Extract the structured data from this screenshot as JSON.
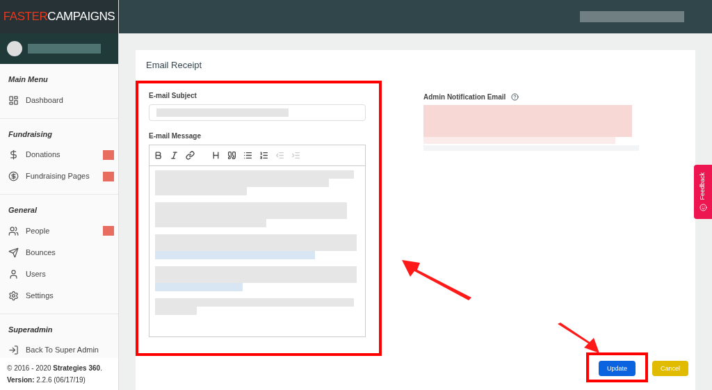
{
  "brand": {
    "part_1": "FASTER",
    "part_2": "CAMPAIGNS"
  },
  "sidebar": {
    "sections": [
      {
        "title": "Main Menu",
        "items": [
          {
            "label": "Dashboard",
            "kind": "dashboard",
            "badge": false
          }
        ]
      },
      {
        "title": "Fundraising",
        "items": [
          {
            "label": "Donations",
            "kind": "dollar",
            "badge": true
          },
          {
            "label": "Fundraising Pages",
            "kind": "dollar-circle",
            "badge": true
          }
        ]
      },
      {
        "title": "General",
        "items": [
          {
            "label": "People",
            "kind": "people",
            "badge": true
          },
          {
            "label": "Bounces",
            "kind": "send",
            "badge": false
          },
          {
            "label": "Users",
            "kind": "user",
            "badge": false
          },
          {
            "label": "Settings",
            "kind": "gear",
            "badge": false
          }
        ]
      },
      {
        "title": "Superadmin",
        "items": [
          {
            "label": "Back To Super Admin",
            "kind": "login",
            "badge": false
          }
        ]
      }
    ],
    "footer": {
      "copyright": "© 2016 - 2020 **Strategies 360**.",
      "version": "**Version:** 2.2.6 (06/17/19)"
    }
  },
  "card": {
    "title": "Email Receipt",
    "subject": {
      "label": "E-mail Subject"
    },
    "message": {
      "label": "E-mail Message",
      "toolbar": [
        {
          "kind": "bold",
          "disabled": false
        },
        {
          "kind": "italic",
          "disabled": false
        },
        {
          "kind": "link",
          "disabled": false
        },
        {
          "kind": "heading",
          "disabled": false
        },
        {
          "kind": "quote",
          "disabled": false
        },
        {
          "kind": "bullets",
          "disabled": false
        },
        {
          "kind": "numbers",
          "disabled": false
        },
        {
          "kind": "outdent",
          "disabled": true
        },
        {
          "kind": "indent",
          "disabled": true
        }
      ]
    },
    "admin": {
      "label": "Admin Notification Email"
    },
    "buttons": [
      {
        "label": "Update",
        "kind": "primary",
        "highlighted": true
      },
      {
        "label": "Cancel",
        "kind": "warning",
        "highlighted": false
      }
    ]
  },
  "feedback": {
    "label": "Feedback"
  }
}
